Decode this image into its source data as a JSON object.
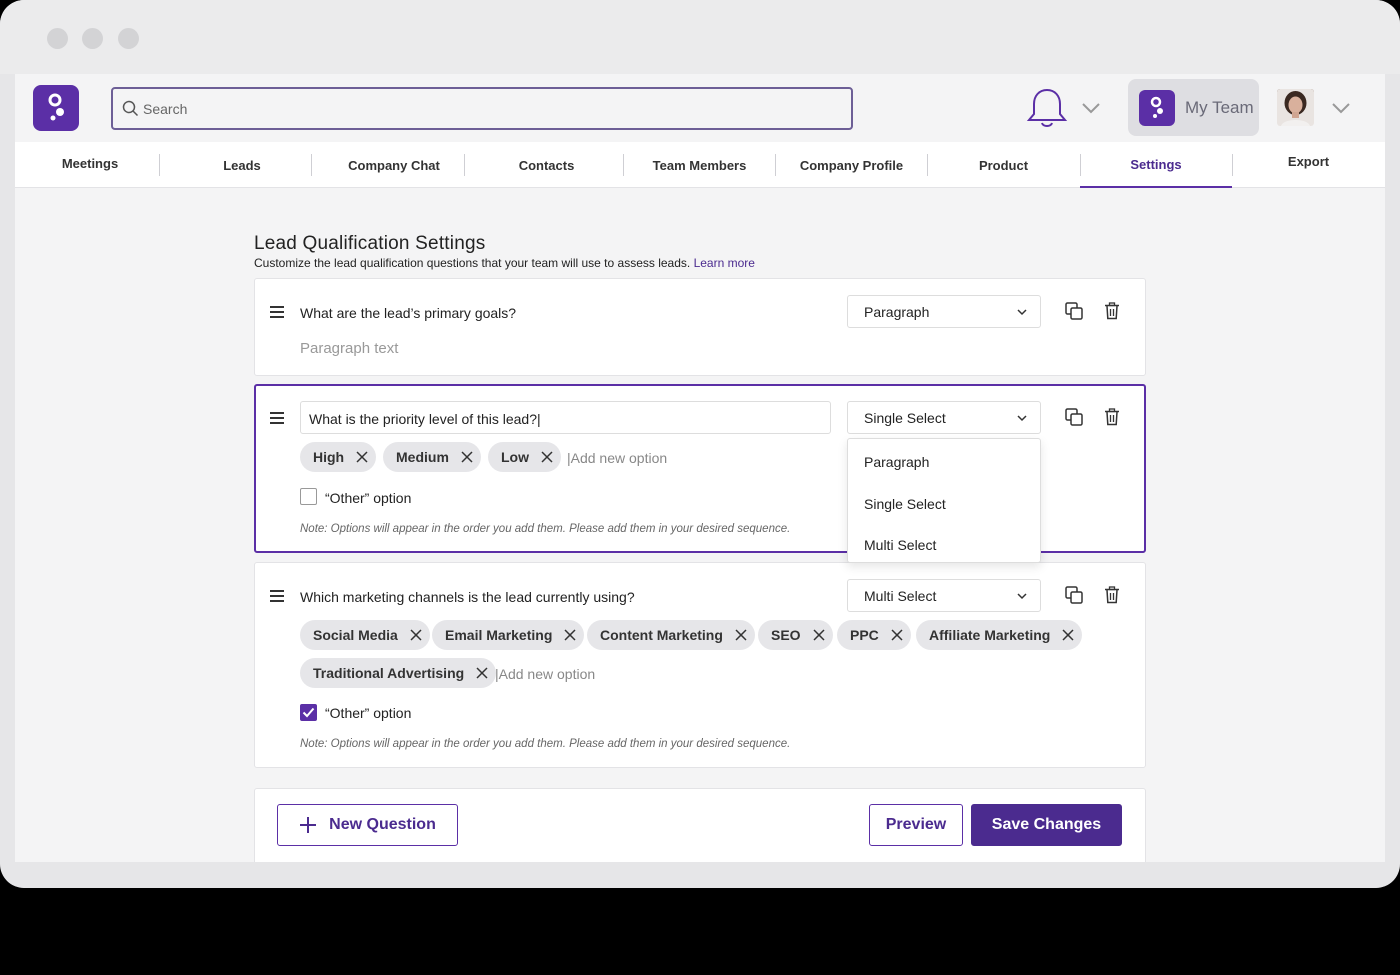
{
  "window": {
    "traffic_lights": [
      "close",
      "minimize",
      "maximize"
    ]
  },
  "header": {
    "search_placeholder": "Search",
    "team_label": "My Team",
    "icons": [
      "search-icon",
      "bell-icon",
      "chevron-down-icon",
      "avatar"
    ]
  },
  "nav": {
    "items": [
      "Meetings",
      "Leads",
      "Company Chat",
      "Contacts",
      "Team Members",
      "Company Profile",
      "Product",
      "Settings",
      "Export"
    ],
    "active": "Settings"
  },
  "page": {
    "title": "Lead Qualification Settings",
    "subtitle": "Customize the lead qualification questions that your team will use to assess leads.",
    "learn_more": "Learn more"
  },
  "questions": [
    {
      "text": "What are the lead’s primary goals?",
      "type": "Paragraph",
      "placeholder": "Paragraph text"
    },
    {
      "text": "What is the priority level of this lead?|",
      "type": "Single Select",
      "options": [
        "High",
        "Medium",
        "Low"
      ],
      "add_option_placeholder": "|Add new option",
      "other_option_label": "“Other” option",
      "other_option_checked": false,
      "note": "Note: Options will appear in the order you add them. Please add them in your desired sequence."
    },
    {
      "text": "Which marketing channels is the lead currently using?",
      "type": "Multi Select",
      "options": [
        "Social Media",
        "Email Marketing",
        "Content Marketing",
        "SEO",
        "PPC",
        "Affiliate Marketing",
        "Traditional Advertising"
      ],
      "add_option_placeholder": "|Add new option",
      "other_option_label": "“Other” option",
      "other_option_checked": true,
      "note": "Note: Options will appear in the order you add them. Please add them in your desired sequence."
    }
  ],
  "type_dropdown": {
    "options": [
      "Paragraph",
      "Single Select",
      "Multi Select"
    ]
  },
  "footer": {
    "new_question": "New Question",
    "preview": "Preview",
    "save": "Save Changes"
  },
  "colors": {
    "accent": "#5b2fa6",
    "accent_dark": "#4b2b8f",
    "chip_bg": "#e6e6e9",
    "page_bg": "#f4f4f5"
  }
}
